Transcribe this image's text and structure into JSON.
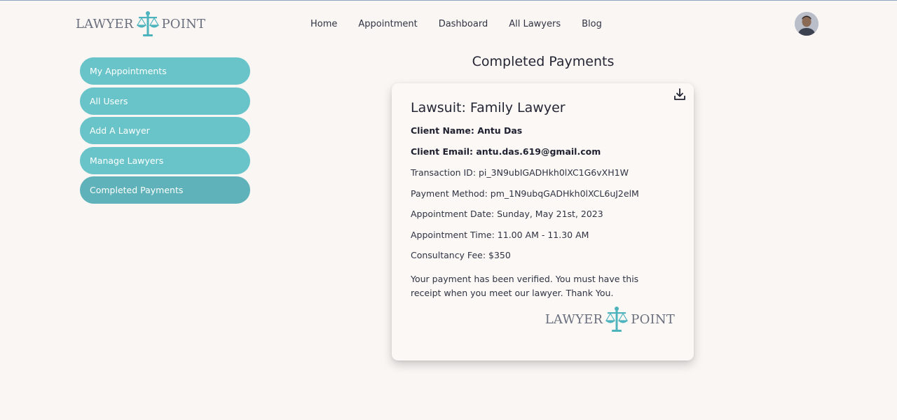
{
  "brand": {
    "word1": "LAWYER",
    "word2": "POINT",
    "accent": "#4db3bd"
  },
  "nav": {
    "items": [
      {
        "label": "Home"
      },
      {
        "label": "Appointment"
      },
      {
        "label": "Dashboard"
      },
      {
        "label": "All Lawyers"
      },
      {
        "label": "Blog"
      }
    ]
  },
  "sidebar": {
    "items": [
      {
        "label": "My Appointments"
      },
      {
        "label": "All Users"
      },
      {
        "label": "Add A Lawyer"
      },
      {
        "label": "Manage Lawyers"
      },
      {
        "label": "Completed Payments"
      }
    ],
    "active": "Completed Payments"
  },
  "main": {
    "title": "Completed Payments"
  },
  "receipt": {
    "lawsuit": "Lawsuit: Family Lawyer",
    "client_name": "Client Name: Antu Das",
    "client_email": "Client Email: antu.das.619@gmail.com",
    "transaction_id": "Transaction ID: pi_3N9ubIGADHkh0lXC1G6vXH1W",
    "payment_method": "Payment Method: pm_1N9ubqGADHkh0lXCL6uJ2elM",
    "appointment_date": "Appointment Date: Sunday, May 21st, 2023",
    "appointment_time": "Appointment Time: 11.00 AM - 11.30 AM",
    "fee": "Consultancy Fee: $350",
    "note": "Your payment has been verified. You must have this receipt when you meet our lawyer. Thank You."
  },
  "icons": {
    "download": "download-icon",
    "logo": "scales-of-justice-icon"
  },
  "colors": {
    "sidebar": "#69c4c9",
    "sidebar_active": "#5fb2b9",
    "background": "#faf6f4"
  }
}
